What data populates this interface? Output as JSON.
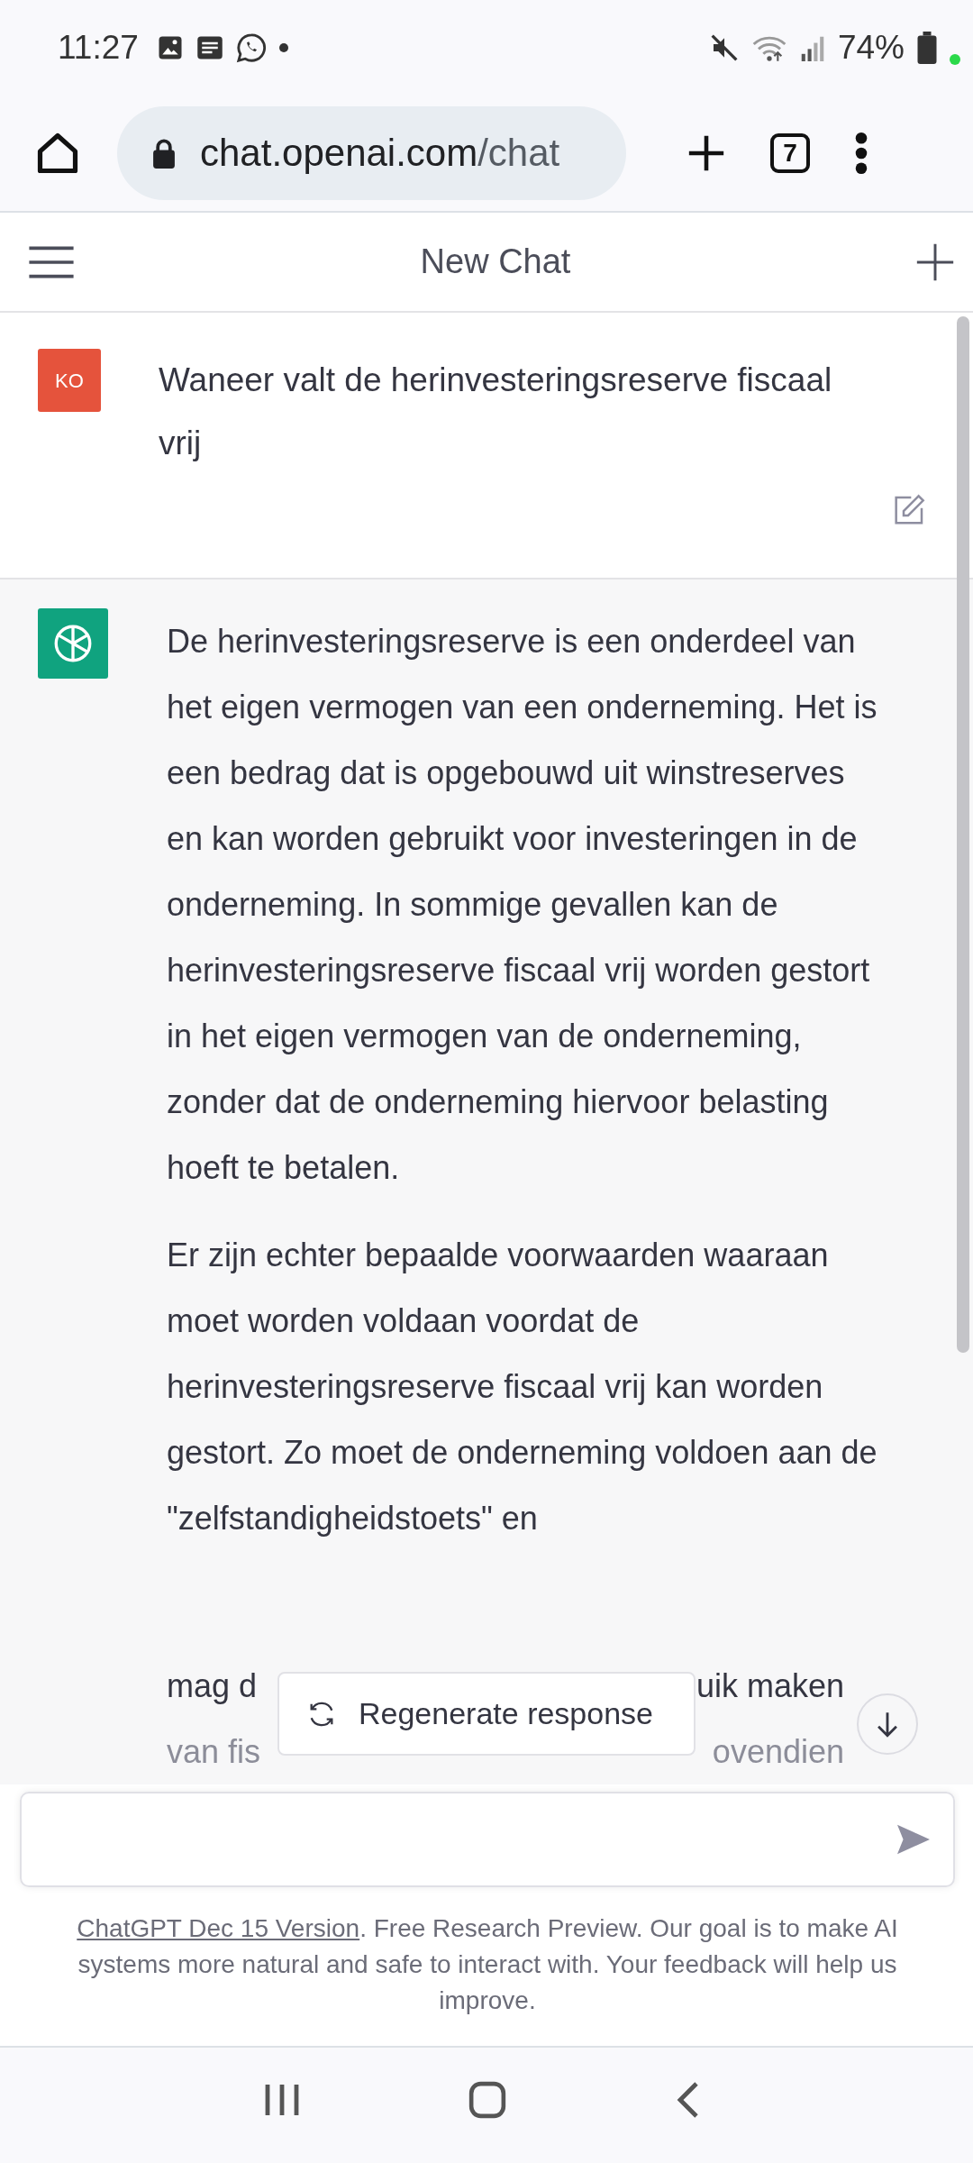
{
  "status_bar": {
    "time": "11:27",
    "battery": "74%"
  },
  "browser": {
    "url_host": "chat.openai.com",
    "url_path": "/chat",
    "tab_count": "7"
  },
  "header": {
    "title": "New Chat"
  },
  "messages": [
    {
      "kind": "user",
      "avatar": "KO",
      "text": "Waneer valt de herinvesteringsreserve fiscaal vrij"
    },
    {
      "kind": "assistant",
      "paragraphs": [
        "De herinvesteringsreserve is een onderdeel van het eigen vermogen van een onderneming. Het is een bedrag dat is opgebouwd uit winstreserves en kan worden gebruikt voor investeringen in de onderneming. In sommige gevallen kan de herinvesteringsreserve fiscaal vrij worden gestort in het eigen vermogen van de onderneming, zonder dat de onderneming hiervoor belasting hoeft te betalen.",
        "Er zijn echter bepaalde voorwaarden waaraan moet worden voldaan voordat de herinvesteringsreserve fiscaal vrij kan worden gestort. Zo moet de onderneming voldoen aan de \"zelfstandigheidstoets\" en"
      ],
      "partial_lines": [
        {
          "left": "mag d",
          "right": "uik maken"
        },
        {
          "left": "van fis",
          "right": "ovendien"
        }
      ]
    }
  ],
  "regenerate_button": "Regenerate response",
  "footer": {
    "link": "ChatGPT Dec 15 Version",
    "text": ". Free Research Preview. Our goal is to make AI systems more natural and safe to interact with. Your feedback will help us improve."
  }
}
